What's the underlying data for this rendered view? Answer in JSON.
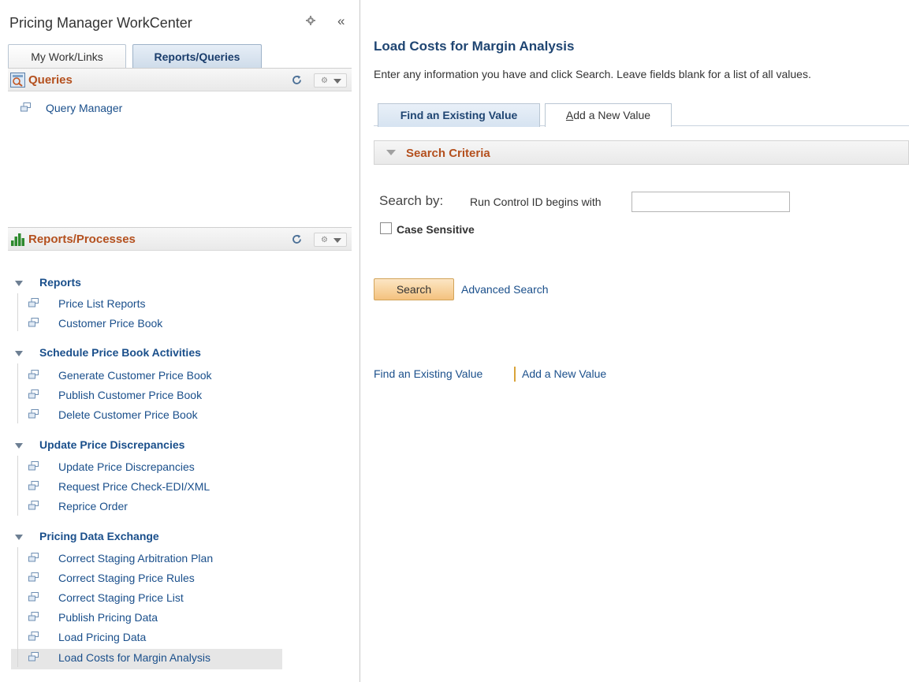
{
  "workcenter": {
    "title": "Pricing Manager WorkCenter",
    "collapse_glyph": "«",
    "tabs": [
      "My Work/Links",
      "Reports/Queries"
    ],
    "queries": {
      "title": "Queries",
      "items": [
        "Query Manager"
      ]
    },
    "splitter": "..........",
    "reports": {
      "title": "Reports/Processes",
      "groups": [
        {
          "label": "Reports",
          "items": [
            "Price List Reports",
            "Customer Price Book"
          ]
        },
        {
          "label": "Schedule Price Book Activities",
          "items": [
            "Generate Customer Price Book",
            "Publish Customer Price Book",
            "Delete Customer Price Book"
          ]
        },
        {
          "label": "Update Price Discrepancies",
          "items": [
            "Update Price Discrepancies",
            "Request Price Check-EDI/XML",
            "Reprice Order"
          ]
        },
        {
          "label": "Pricing Data Exchange",
          "items": [
            "Correct Staging Arbitration Plan",
            "Correct Staging Price Rules",
            "Correct Staging Price List",
            "Publish Pricing Data",
            "Load Pricing Data",
            "Load Costs for Margin Analysis"
          ]
        }
      ]
    }
  },
  "main": {
    "title": "Load Costs for Margin Analysis",
    "instructions": "Enter any information you have and click Search. Leave fields blank for a list of all values.",
    "tab_find": "Find an Existing Value",
    "tab_add_first": "A",
    "tab_add_rest": "dd a New Value",
    "search_criteria": "Search Criteria",
    "search_by": "Search by:",
    "run_control_label": "Run Control ID begins with",
    "run_control_value": "",
    "case_sensitive": "Case Sensitive",
    "search_button": "Search",
    "advanced_search": "Advanced Search",
    "bottom_find": "Find an Existing Value",
    "bottom_add": "Add a New Value"
  },
  "colors": {
    "accent_orange": "#b4501e",
    "link_blue": "#1a4f8b",
    "title_navy": "#1f4572"
  }
}
